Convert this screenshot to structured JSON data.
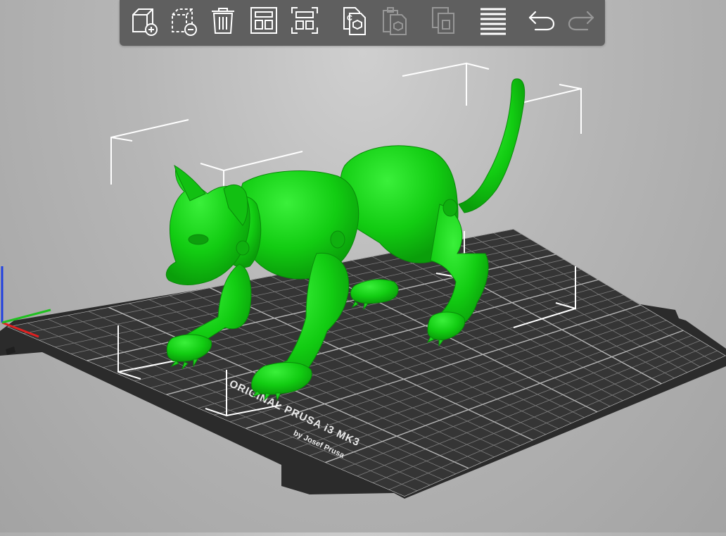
{
  "app": {
    "name": "3D print slicer plater view"
  },
  "toolbar": {
    "buttons": [
      {
        "id": "add",
        "tooltip": "Add",
        "icon": "add-cube-icon",
        "enabled": true
      },
      {
        "id": "delete",
        "tooltip": "Delete",
        "icon": "delete-cube-icon",
        "enabled": true
      },
      {
        "id": "delete_all",
        "tooltip": "Delete all",
        "icon": "trash-icon",
        "enabled": true
      },
      {
        "id": "arrange",
        "tooltip": "Arrange",
        "icon": "arrange-icon",
        "enabled": true
      },
      {
        "id": "arrange_selection",
        "tooltip": "Arrange selection",
        "icon": "arrange-selection-icon",
        "enabled": true
      },
      {
        "id": "copy",
        "tooltip": "Copy",
        "icon": "copy-icon",
        "enabled": true
      },
      {
        "id": "paste",
        "tooltip": "Paste",
        "icon": "paste-icon",
        "enabled": false
      },
      {
        "id": "add_instance",
        "tooltip": "Add instance",
        "icon": "add-instance-icon",
        "enabled": false
      },
      {
        "id": "layers",
        "tooltip": "Layers editing",
        "icon": "layers-icon",
        "enabled": true
      },
      {
        "id": "undo",
        "tooltip": "Undo",
        "icon": "undo-icon",
        "enabled": true
      },
      {
        "id": "redo",
        "tooltip": "Redo",
        "icon": "redo-icon",
        "enabled": false
      }
    ]
  },
  "bed": {
    "title": "ORIGINAL PRUSA i3 MK3",
    "subtitle": "by Josef Prusa",
    "surface_color": "#2e2e2e",
    "grid_color": "#8a8a8a"
  },
  "model": {
    "name": "cat model",
    "color": "#1ed21e",
    "selected": true
  },
  "colors": {
    "background_top": "#cfcfcf",
    "background_bottom": "#a3a3a3",
    "toolbar_bg": "#5f5f5f",
    "selection_box": "#ffffff",
    "axis_x": "#e02020",
    "axis_y": "#20c020",
    "axis_z": "#2040e0"
  }
}
